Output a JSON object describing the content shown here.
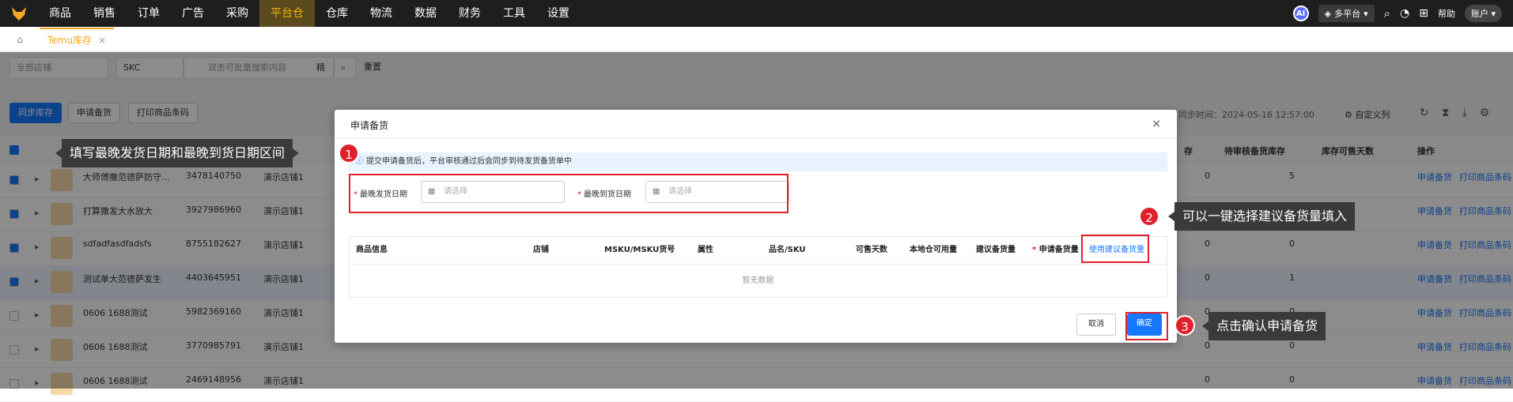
{
  "nav": [
    "商品",
    "销售",
    "订单",
    "广告",
    "采购",
    "平台仓",
    "仓库",
    "物流",
    "数据",
    "财务",
    "工具",
    "设置"
  ],
  "top_right": {
    "ai": "AI",
    "platform": "多平台",
    "help": "帮助",
    "account": "账户"
  },
  "tab": {
    "label": "Temu库存",
    "close": "×"
  },
  "filters": {
    "store": "全部店铺",
    "skc": "SKC",
    "search_placeholder": "双击可批量搜索内容",
    "exact": "精",
    "reset": "重置"
  },
  "buttons": {
    "sync": "同步库存",
    "apply": "申请备货",
    "print": "打印商品条码"
  },
  "right_bar": {
    "sync_time": "同步时间：2024-05-16 12:57:00",
    "custom_cols": "自定义列"
  },
  "bg_headers": [
    "存",
    "待审核备货库存",
    "库存可售天数",
    "操作"
  ],
  "bg_rows": [
    {
      "name": "大师傅撒范德萨防守…",
      "id": "3478140750",
      "store": "演示店铺1",
      "v1": "0",
      "v2": "5",
      "op1": "申请备货",
      "op2": "打印商品条码"
    },
    {
      "name": "打算撒发大水放大",
      "id": "3927986960",
      "store": "演示店铺1",
      "v1": "0",
      "v2": "0",
      "op1": "申请备货",
      "op2": "打印商品条码"
    },
    {
      "name": "sdfadfasdfadsfs",
      "id": "8755182627",
      "store": "演示店铺1",
      "v1": "0",
      "v2": "0",
      "op1": "申请备货",
      "op2": "打印商品条码"
    },
    {
      "name": "测试单大范德萨发生",
      "id": "4403645951",
      "store": "演示店铺1",
      "v1": "0",
      "v2": "1",
      "op1": "申请备货",
      "op2": "打印商品条码"
    },
    {
      "name": "0606 1688测试",
      "id": "5982369160",
      "store": "演示店铺1",
      "v1": "0",
      "v2": "0",
      "op1": "申请备货",
      "op2": "打印商品条码"
    },
    {
      "name": "0606 1688测试",
      "id": "3770985791",
      "store": "演示店铺1",
      "v1": "0",
      "v2": "0",
      "op1": "申请备货",
      "op2": "打印商品条码"
    },
    {
      "name": "0606 1688测试",
      "id": "2469148956",
      "store": "演示店铺1",
      "v1": "0",
      "v2": "0",
      "op1": "申请备货",
      "op2": "打印商品条码"
    }
  ],
  "modal": {
    "title": "申请备货",
    "close": "×",
    "info": "提交申请备货后，平台审核通过后会同步到待发货备货单中",
    "ship_label": "最晚发货日期",
    "arrive_label": "最晚到货日期",
    "placeholder": "请选择",
    "columns": [
      "商品信息",
      "店铺",
      "MSKU/MSKU货号",
      "属性",
      "品名/SKU",
      "可售天数",
      "本地仓可用量",
      "建议备货量",
      "申请备货量"
    ],
    "use_suggest": "使用建议备货量",
    "empty": "暂无数据",
    "cancel": "取消",
    "confirm": "确定"
  },
  "callouts": {
    "c1": "填写最晚发货日期和最晚到货日期区间",
    "c2": "可以一键选择建议备货量填入",
    "c3": "点击确认申请备货",
    "n1": "1",
    "n2": "2",
    "n3": "3"
  },
  "colors": {
    "accent": "#1677ff",
    "warning": "#f5a623",
    "mark": "#e0202a"
  }
}
